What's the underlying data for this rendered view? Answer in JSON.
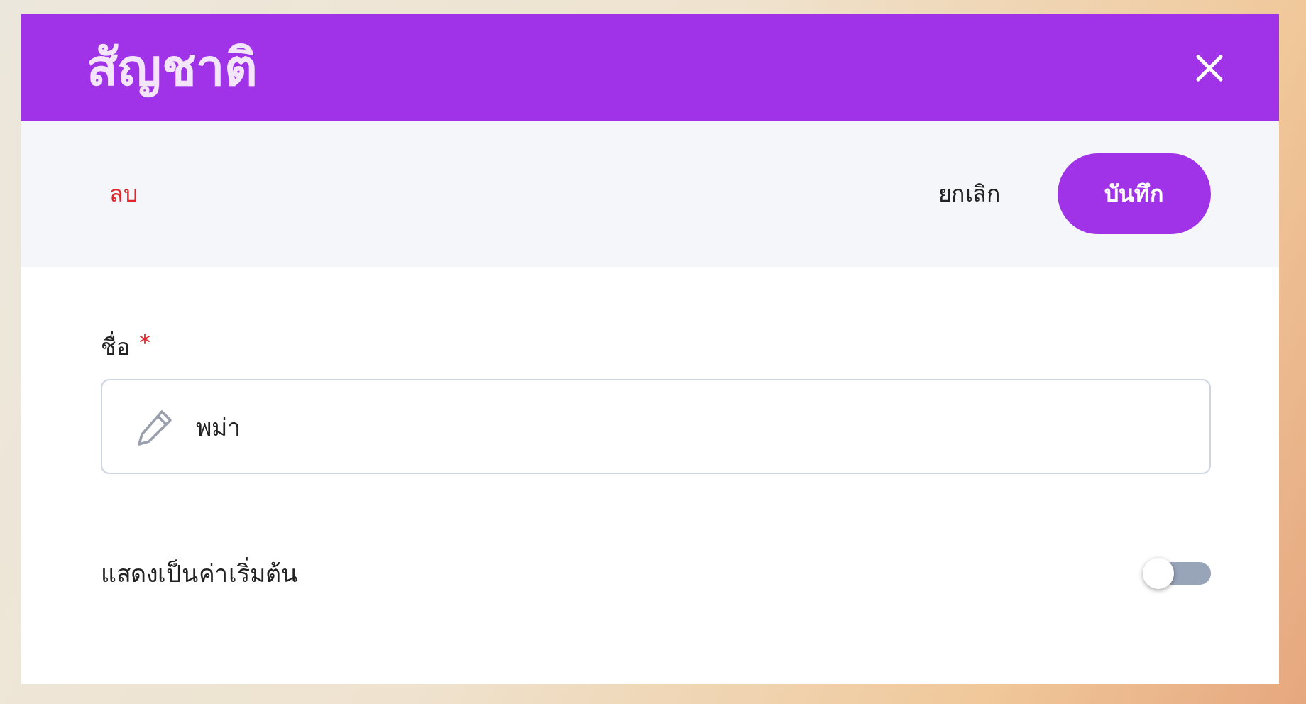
{
  "dialog": {
    "title": "สัญชาติ"
  },
  "actions": {
    "delete": "ลบ",
    "cancel": "ยกเลิก",
    "save": "บันทึก"
  },
  "fields": [
    {
      "kind": "text",
      "label": "ชื่อ",
      "required_mark": "*",
      "value": "พม่า"
    },
    {
      "kind": "toggle",
      "label": "แสดงเป็นค่าเริ่มต้น",
      "on": false
    }
  ]
}
